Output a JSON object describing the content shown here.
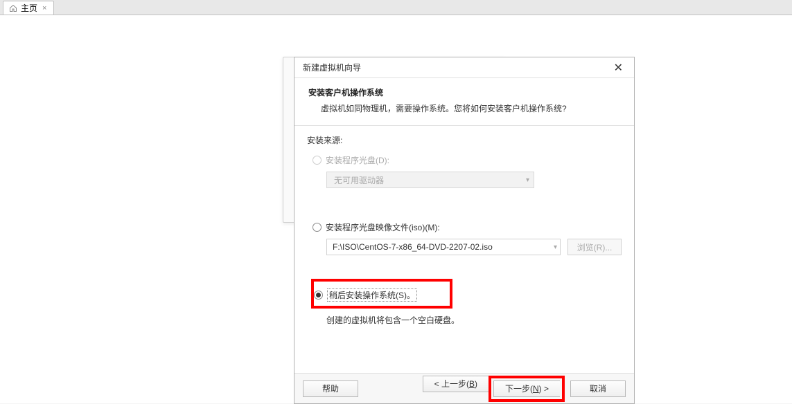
{
  "tab": {
    "label": "主页",
    "close": "×"
  },
  "wizard": {
    "title": "新建虚拟机向导",
    "close": "✕",
    "header_title": "安装客户机操作系统",
    "header_desc": "虚拟机如同物理机，需要操作系统。您将如何安装客户机操作系统?",
    "section_label": "安装来源:",
    "option_disc": "安装程序光盘(D):",
    "disc_select": "无可用驱动器",
    "option_iso": "安装程序光盘映像文件(iso)(M):",
    "iso_path": "F:\\ISO\\CentOS-7-x86_64-DVD-2207-02.iso",
    "browse": "浏览(R)...",
    "option_later": "稍后安装操作系统(S)。",
    "later_desc": "创建的虚拟机将包含一个空白硬盘。",
    "help": "帮助",
    "back_prefix": "< 上一步(",
    "back_key": "B",
    "back_suffix": ")",
    "next_prefix": "下一步(",
    "next_key": "N",
    "next_suffix": ") >",
    "cancel": "取消"
  }
}
